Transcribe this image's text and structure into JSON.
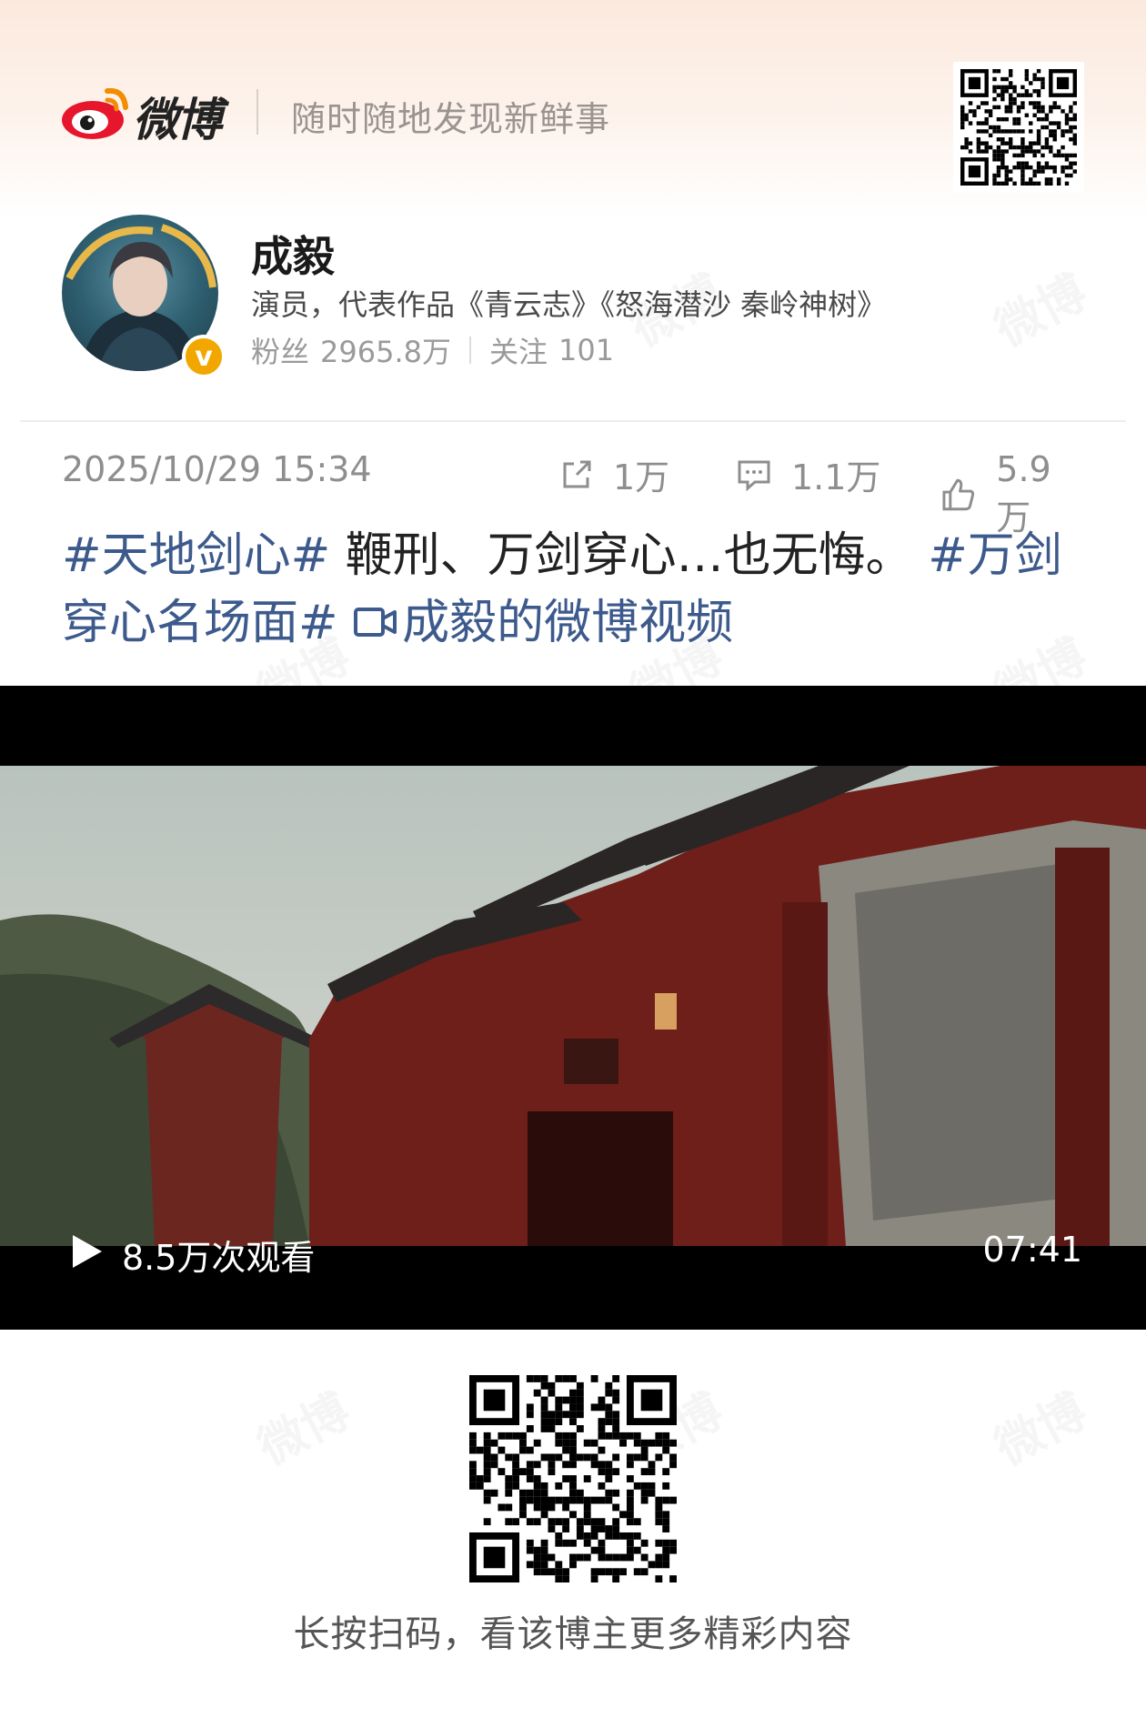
{
  "brand": {
    "name": "微博",
    "slogan": "随时随地发现新鲜事"
  },
  "user": {
    "name": "成毅",
    "description": "演员，代表作品《青云志》《怒海潜沙 秦岭神树》",
    "fans_label": "粉丝",
    "fans_count": "2965.8万",
    "follow_label": "关注",
    "follow_count": "101"
  },
  "post": {
    "timestamp": "2025/10/29 15:34",
    "reposts": "1万",
    "comments": "1.1万",
    "likes": "5.9万",
    "tag1": "#天地剑心#",
    "text1": " 鞭刑、万剑穿心…也无悔。 ",
    "tag2": "#万剑穿心名场面#",
    "video_link": "成毅的微博视频"
  },
  "video": {
    "views": "8.5万次观看",
    "duration": "07:41"
  },
  "footer": {
    "cta": "长按扫码，看该博主更多精彩内容"
  },
  "watermark": "微博",
  "colors": {
    "tag_blue": "#3d5a8c",
    "verified_gold": "#f2a700",
    "weibo_red": "#e6162d"
  }
}
